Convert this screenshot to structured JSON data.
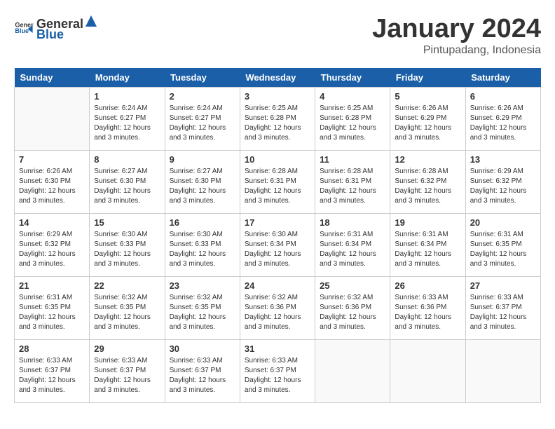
{
  "header": {
    "logo_general": "General",
    "logo_blue": "Blue",
    "month_year": "January 2024",
    "location": "Pintupadang, Indonesia"
  },
  "days_of_week": [
    "Sunday",
    "Monday",
    "Tuesday",
    "Wednesday",
    "Thursday",
    "Friday",
    "Saturday"
  ],
  "weeks": [
    [
      {
        "day": "",
        "info": ""
      },
      {
        "day": "1",
        "info": "Sunrise: 6:24 AM\nSunset: 6:27 PM\nDaylight: 12 hours\nand 3 minutes."
      },
      {
        "day": "2",
        "info": "Sunrise: 6:24 AM\nSunset: 6:27 PM\nDaylight: 12 hours\nand 3 minutes."
      },
      {
        "day": "3",
        "info": "Sunrise: 6:25 AM\nSunset: 6:28 PM\nDaylight: 12 hours\nand 3 minutes."
      },
      {
        "day": "4",
        "info": "Sunrise: 6:25 AM\nSunset: 6:28 PM\nDaylight: 12 hours\nand 3 minutes."
      },
      {
        "day": "5",
        "info": "Sunrise: 6:26 AM\nSunset: 6:29 PM\nDaylight: 12 hours\nand 3 minutes."
      },
      {
        "day": "6",
        "info": "Sunrise: 6:26 AM\nSunset: 6:29 PM\nDaylight: 12 hours\nand 3 minutes."
      }
    ],
    [
      {
        "day": "7",
        "info": "Sunrise: 6:26 AM\nSunset: 6:30 PM\nDaylight: 12 hours\nand 3 minutes."
      },
      {
        "day": "8",
        "info": "Sunrise: 6:27 AM\nSunset: 6:30 PM\nDaylight: 12 hours\nand 3 minutes."
      },
      {
        "day": "9",
        "info": "Sunrise: 6:27 AM\nSunset: 6:30 PM\nDaylight: 12 hours\nand 3 minutes."
      },
      {
        "day": "10",
        "info": "Sunrise: 6:28 AM\nSunset: 6:31 PM\nDaylight: 12 hours\nand 3 minutes."
      },
      {
        "day": "11",
        "info": "Sunrise: 6:28 AM\nSunset: 6:31 PM\nDaylight: 12 hours\nand 3 minutes."
      },
      {
        "day": "12",
        "info": "Sunrise: 6:28 AM\nSunset: 6:32 PM\nDaylight: 12 hours\nand 3 minutes."
      },
      {
        "day": "13",
        "info": "Sunrise: 6:29 AM\nSunset: 6:32 PM\nDaylight: 12 hours\nand 3 minutes."
      }
    ],
    [
      {
        "day": "14",
        "info": "Sunrise: 6:29 AM\nSunset: 6:32 PM\nDaylight: 12 hours\nand 3 minutes."
      },
      {
        "day": "15",
        "info": "Sunrise: 6:30 AM\nSunset: 6:33 PM\nDaylight: 12 hours\nand 3 minutes."
      },
      {
        "day": "16",
        "info": "Sunrise: 6:30 AM\nSunset: 6:33 PM\nDaylight: 12 hours\nand 3 minutes."
      },
      {
        "day": "17",
        "info": "Sunrise: 6:30 AM\nSunset: 6:34 PM\nDaylight: 12 hours\nand 3 minutes."
      },
      {
        "day": "18",
        "info": "Sunrise: 6:31 AM\nSunset: 6:34 PM\nDaylight: 12 hours\nand 3 minutes."
      },
      {
        "day": "19",
        "info": "Sunrise: 6:31 AM\nSunset: 6:34 PM\nDaylight: 12 hours\nand 3 minutes."
      },
      {
        "day": "20",
        "info": "Sunrise: 6:31 AM\nSunset: 6:35 PM\nDaylight: 12 hours\nand 3 minutes."
      }
    ],
    [
      {
        "day": "21",
        "info": "Sunrise: 6:31 AM\nSunset: 6:35 PM\nDaylight: 12 hours\nand 3 minutes."
      },
      {
        "day": "22",
        "info": "Sunrise: 6:32 AM\nSunset: 6:35 PM\nDaylight: 12 hours\nand 3 minutes."
      },
      {
        "day": "23",
        "info": "Sunrise: 6:32 AM\nSunset: 6:35 PM\nDaylight: 12 hours\nand 3 minutes."
      },
      {
        "day": "24",
        "info": "Sunrise: 6:32 AM\nSunset: 6:36 PM\nDaylight: 12 hours\nand 3 minutes."
      },
      {
        "day": "25",
        "info": "Sunrise: 6:32 AM\nSunset: 6:36 PM\nDaylight: 12 hours\nand 3 minutes."
      },
      {
        "day": "26",
        "info": "Sunrise: 6:33 AM\nSunset: 6:36 PM\nDaylight: 12 hours\nand 3 minutes."
      },
      {
        "day": "27",
        "info": "Sunrise: 6:33 AM\nSunset: 6:37 PM\nDaylight: 12 hours\nand 3 minutes."
      }
    ],
    [
      {
        "day": "28",
        "info": "Sunrise: 6:33 AM\nSunset: 6:37 PM\nDaylight: 12 hours\nand 3 minutes."
      },
      {
        "day": "29",
        "info": "Sunrise: 6:33 AM\nSunset: 6:37 PM\nDaylight: 12 hours\nand 3 minutes."
      },
      {
        "day": "30",
        "info": "Sunrise: 6:33 AM\nSunset: 6:37 PM\nDaylight: 12 hours\nand 3 minutes."
      },
      {
        "day": "31",
        "info": "Sunrise: 6:33 AM\nSunset: 6:37 PM\nDaylight: 12 hours\nand 3 minutes."
      },
      {
        "day": "",
        "info": ""
      },
      {
        "day": "",
        "info": ""
      },
      {
        "day": "",
        "info": ""
      }
    ]
  ]
}
